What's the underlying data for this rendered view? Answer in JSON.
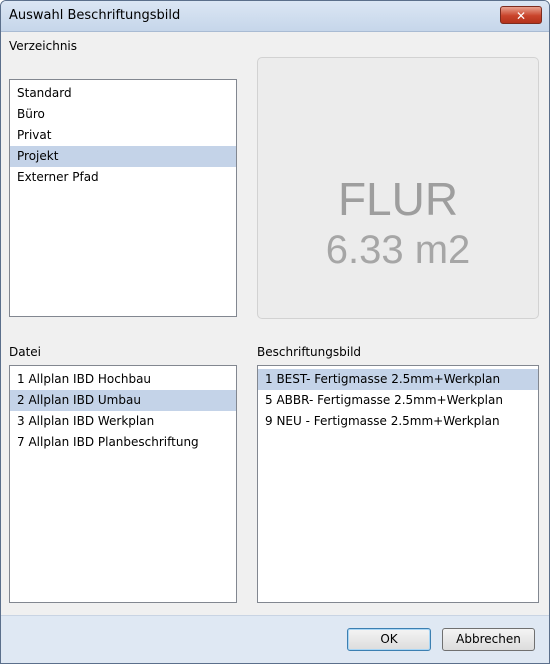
{
  "window": {
    "title": "Auswahl Beschriftungsbild",
    "close_label": "✕"
  },
  "verzeichnis": {
    "label": "Verzeichnis",
    "items": [
      "Standard",
      "Büro",
      "Privat",
      "Projekt",
      "Externer Pfad"
    ],
    "selected": "Projekt"
  },
  "preview": {
    "line1": "FLUR",
    "line2": "6.33 m2"
  },
  "datei": {
    "label": "Datei",
    "items": [
      "1 Allplan IBD Hochbau",
      "2 Allplan IBD Umbau",
      "3 Allplan IBD Werkplan",
      "7 Allplan IBD Planbeschriftung"
    ],
    "selected": "2 Allplan IBD Umbau"
  },
  "beschriftungsbild": {
    "label": "Beschriftungsbild",
    "items": [
      "1 BEST- Fertigmasse 2.5mm+Werkplan",
      "5 ABBR- Fertigmasse 2.5mm+Werkplan",
      "9 NEU - Fertigmasse 2.5mm+Werkplan"
    ],
    "selected": "1 BEST- Fertigmasse 2.5mm+Werkplan"
  },
  "buttons": {
    "ok": "OK",
    "cancel": "Abbrechen"
  },
  "colors": {
    "selection": "#c4d3e8",
    "footer": "#dfe8f3",
    "close": "#c9442b"
  }
}
